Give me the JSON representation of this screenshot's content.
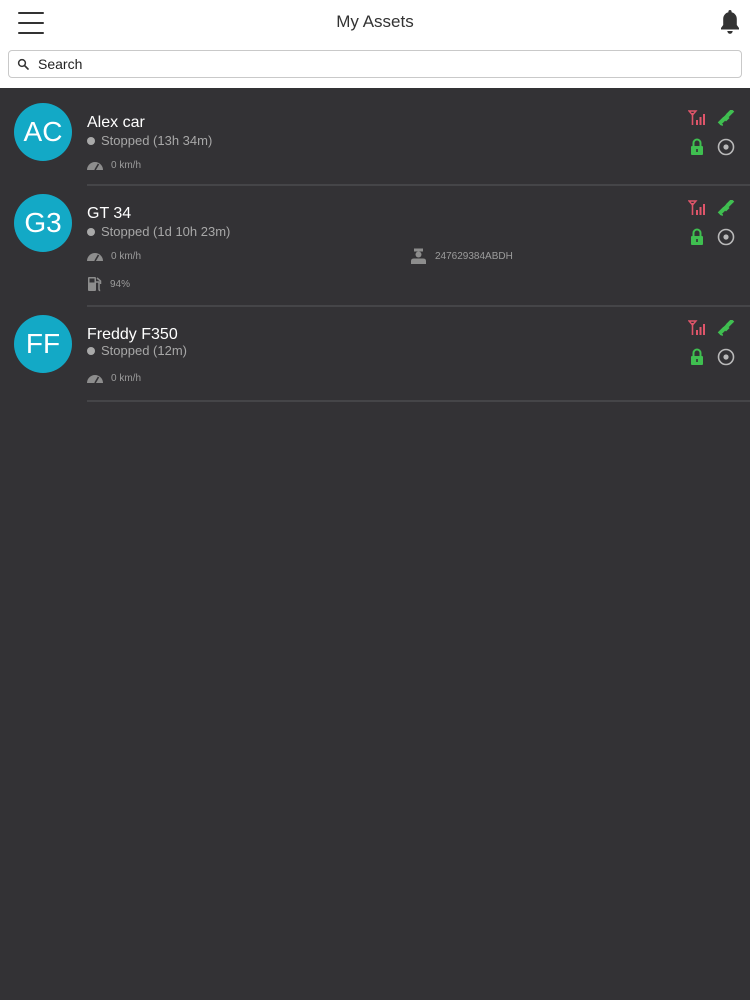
{
  "header": {
    "title": "My Assets",
    "menu_icon": "hamburger-icon",
    "notifications_icon": "bell-icon"
  },
  "search": {
    "placeholder": "Search",
    "value": ""
  },
  "colors": {
    "avatar_bg": "#13a9c6",
    "signal_red": "#e0556a",
    "gps_green": "#3fbf50",
    "lock_green": "#3fbf50",
    "background": "#333235"
  },
  "assets": [
    {
      "initials": "AC",
      "name": "Alex car",
      "status": "Stopped (13h 34m)",
      "speed": "0 km/h"
    },
    {
      "initials": "G3",
      "name": "GT 34",
      "status": "Stopped (1d 10h 23m)",
      "speed": "0 km/h",
      "driver_id": "247629384ABDH",
      "fuel": "94%"
    },
    {
      "initials": "FF",
      "name": "Freddy F350",
      "status": "Stopped (12m)",
      "speed": "0 km/h"
    }
  ]
}
